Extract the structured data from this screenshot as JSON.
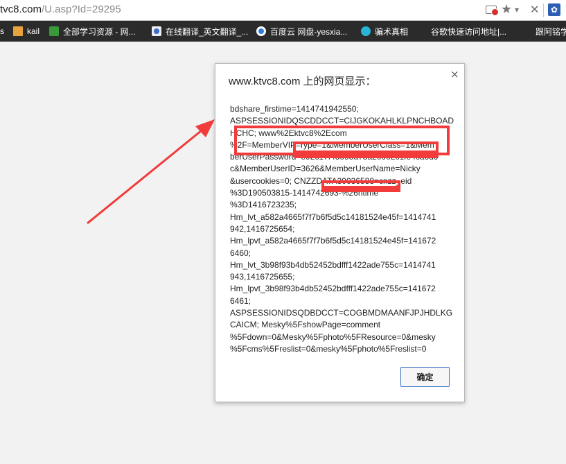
{
  "browser": {
    "url_host": "tvc8.com",
    "url_path": "/U.asp?Id=29295"
  },
  "bookmarks": [
    {
      "label": "s",
      "icon": "bookmark-icon"
    },
    {
      "label": "kail",
      "icon": "folder-icon"
    },
    {
      "label": "全部学习资源 - 网...",
      "icon": "bookmark-icon"
    },
    {
      "label": "在线翻译_英文翻译_...",
      "icon": "translate-icon"
    },
    {
      "label": "百度云 网盘-yesxia...",
      "icon": "baidu-cloud-icon"
    },
    {
      "label": "骗术真相",
      "icon": "shield-icon"
    },
    {
      "label": "谷歌快速访问地址|...",
      "icon": ""
    },
    {
      "label": "跟阿铭学",
      "icon": ""
    }
  ],
  "dialog": {
    "title": "www.ktvc8.com 上的网页显示：",
    "message_lines": [
      "bdshare_firstime=1414741942550;",
      "ASPSESSIONIDQSCDDCCT=CIJGKOKAHLKLPNCHBOAD",
      "HCHC; www%2Ektvc8%2Ecom",
      "%2F=MemberVIP=rype=1&MemberUserClass=1&Mem",
      "berUserPassword=e92c17f4d095a73a20902c1fe4ca6d9",
      "c&MemberUserID=3626&MemberUserName=Nicky",
      "&usercookies=0; CNZZDATA30036588=cnzz_eid",
      "%3D190503815-1414742693-%26ntime",
      "%3D1416723235;",
      "Hm_lvt_a582a4665f7f7b6f5d5c14181524e45f=1414741",
      "942,1416725654;",
      "Hm_lpvt_a582a4665f7f7b6f5d5c14181524e45f=141672",
      "6460;",
      "Hm_lvt_3b98f93b4db52452bdfff1422ade755c=1414741",
      "943,1416725655;",
      "Hm_lpvt_3b98f93b4db52452bdfff1422ade755c=141672",
      "6461;",
      "ASPSESSIONIDSQDBDCCT=COGBMDMAANFJPJHDLKG",
      "CAICM; Mesky%5FshowPage=comment",
      "%5Fdown=0&Mesky%5Fphoto%5FResource=0&mesky",
      "%5Fcms%5Freslist=0&mesky%5Fphoto%5Freslist=0"
    ],
    "ok_label": "确定",
    "close_glyph": "×"
  },
  "colors": {
    "annotation_red": "#f23b3b",
    "bookmarks_bar": "#2b2b2b",
    "button_border": "#3a73c7"
  }
}
